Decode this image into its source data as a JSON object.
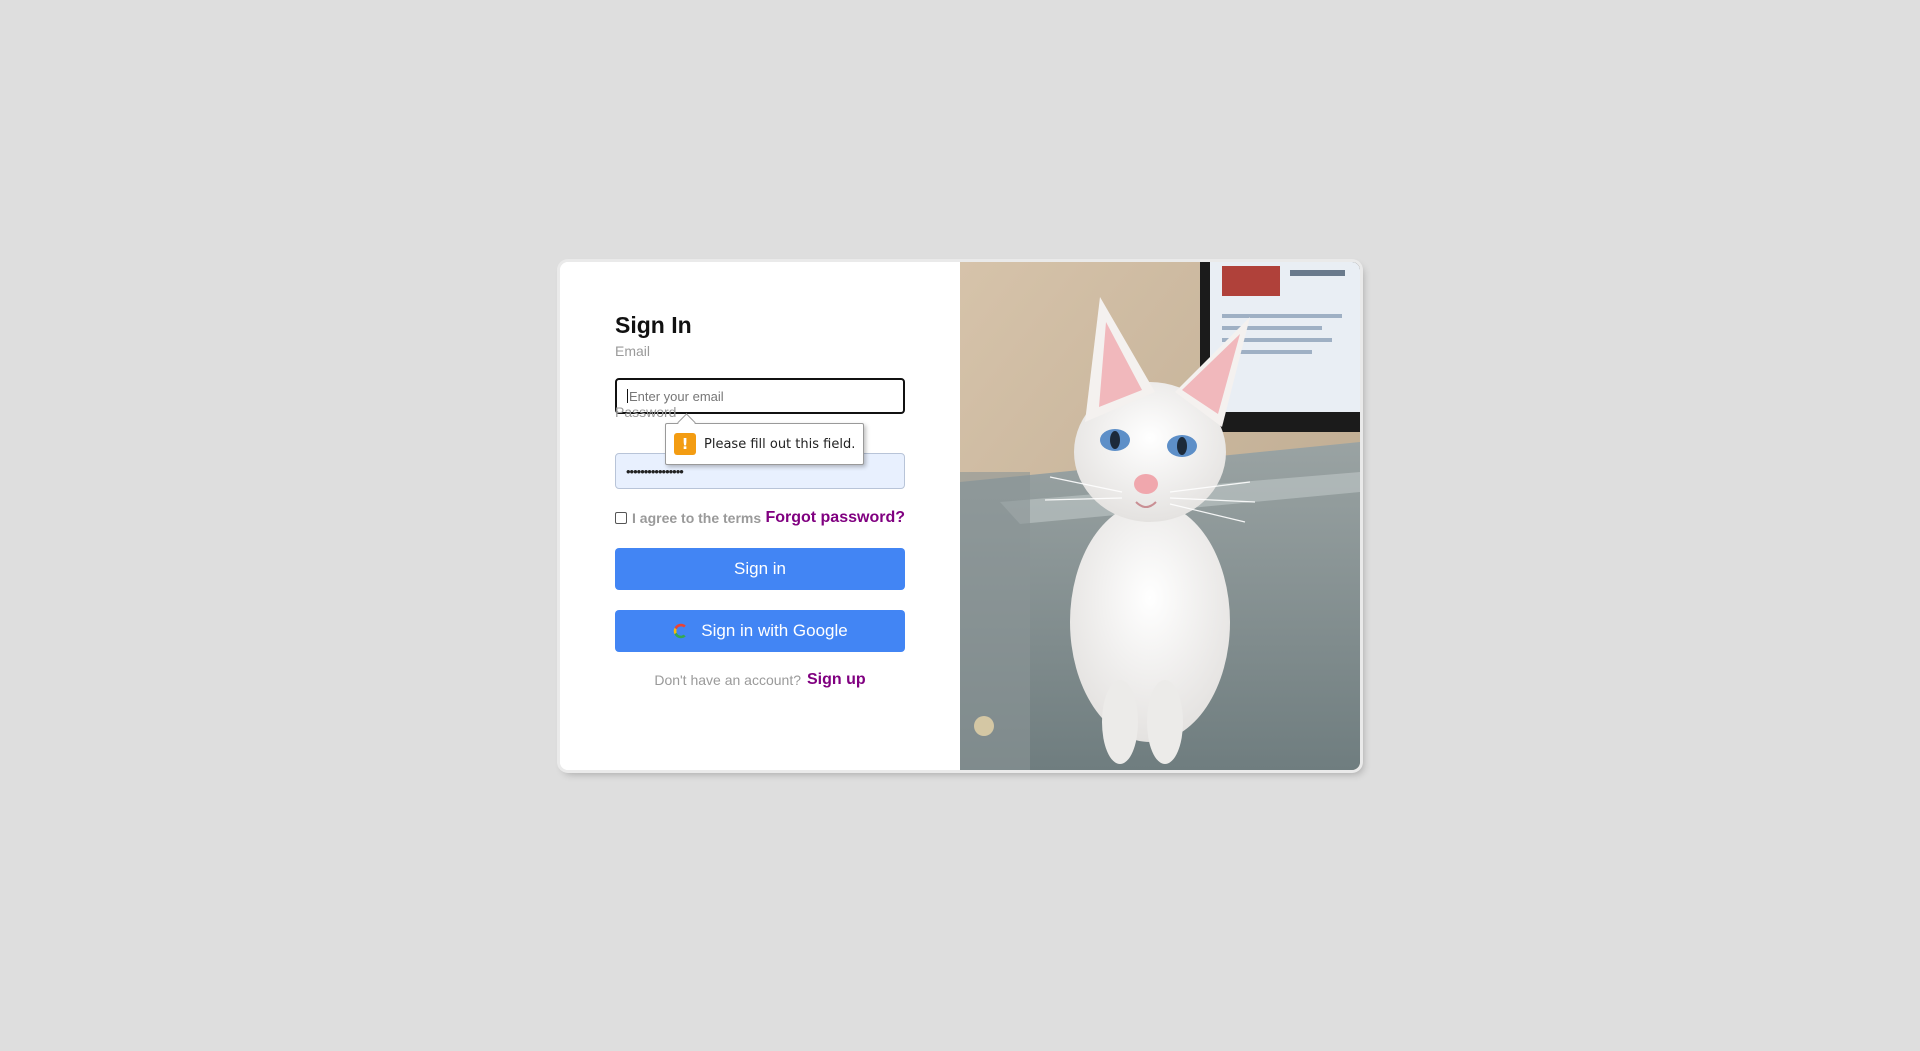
{
  "form": {
    "title": "Sign In",
    "email_label": "Email",
    "email_value": "",
    "email_placeholder": "Enter your email",
    "password_label": "Password",
    "password_value": "••••••••••••••••",
    "validation_message": "Please fill out this field.",
    "validation_icon": "warning-icon",
    "terms_label": "I agree to the terms",
    "terms_checked": false,
    "forgot_password_label": "Forgot password?",
    "sign_in_label": "Sign in",
    "google_sign_in_label": "Sign in with Google",
    "no_account_text": "Don't have an account?",
    "sign_up_label": "Sign up"
  },
  "colors": {
    "page_background": "#dedede",
    "primary_button": "#4285f4",
    "link": "#800080",
    "muted_text": "#9a9a9a",
    "warning": "#f39c12",
    "autofill_background": "#e8f0fe"
  },
  "hero": {
    "image": "photo-white-cat-on-glass-desk"
  }
}
